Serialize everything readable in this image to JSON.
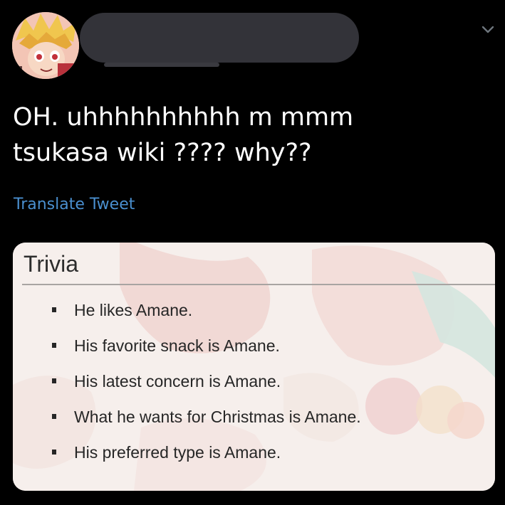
{
  "tweet": {
    "text_lines": [
      "OH. uhhhhhhhhhh m mmm",
      "tsukasa wiki ???? why??"
    ],
    "translate_label": "Translate Tweet",
    "more_icon": "chevron-down-icon",
    "author_redacted": true
  },
  "card": {
    "heading": "Trivia",
    "items": [
      "He likes Amane.",
      "His favorite snack is Amane.",
      "His latest concern is Amane.",
      "What he wants for Christmas is Amane.",
      "His preferred type is Amane."
    ]
  },
  "colors": {
    "background": "#000000",
    "text": "#ffffff",
    "link": "#4a8fcf",
    "redaction": "#333339",
    "card_background": "#f6efec"
  }
}
